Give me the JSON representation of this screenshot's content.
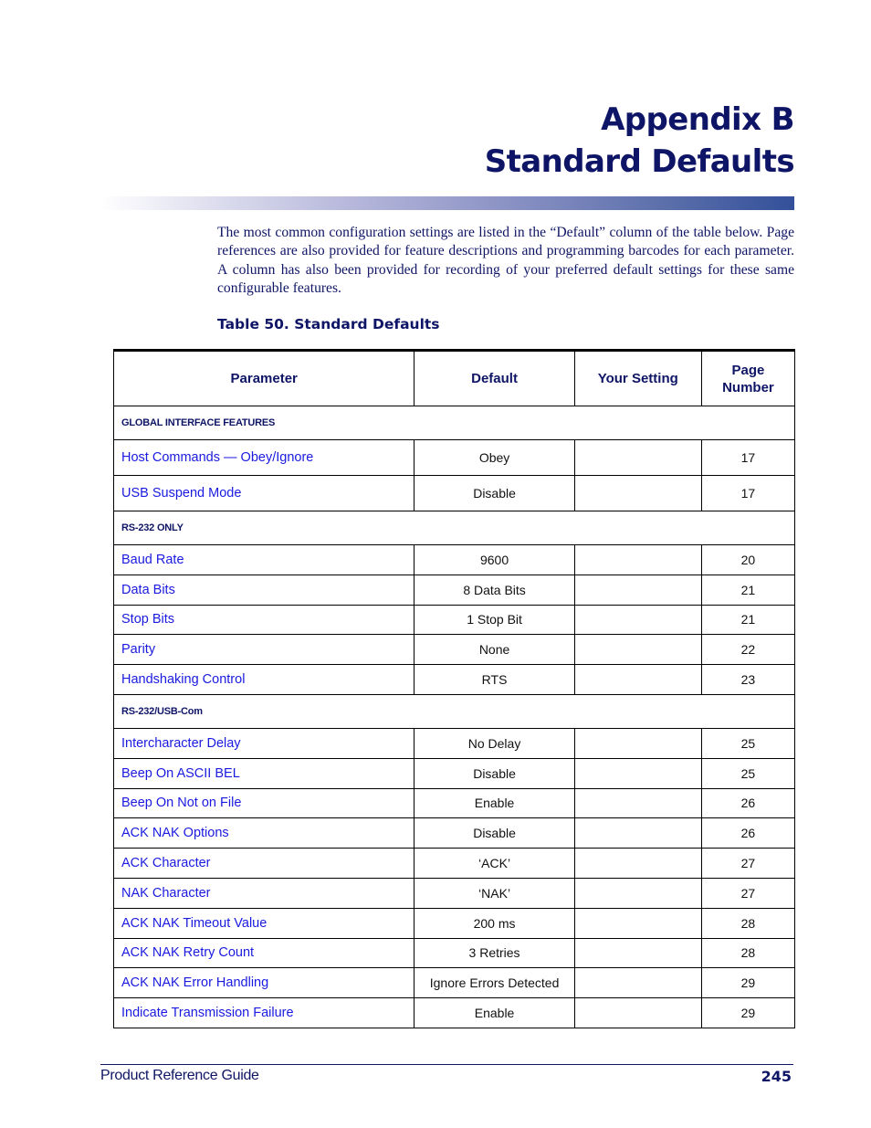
{
  "header": {
    "title_line1": "Appendix B",
    "title_line2": "Standard Defaults"
  },
  "intro_text": "The most common configuration settings are listed in the “Default” column of the table below. Page references are also provided for feature descriptions and programming barcodes for each parameter. A column has also been provided for recording of your preferred default settings for these same configurable features.",
  "table": {
    "caption": "Table 50. Standard Defaults",
    "columns": {
      "parameter": "Parameter",
      "default": "Default",
      "your_setting": "Your Setting",
      "page_line1": "Page",
      "page_line2": "Number"
    },
    "sections": [
      {
        "title": "GLOBAL INTERFACE FEATURES",
        "rows": [
          {
            "parameter": "Host Commands — Obey/Ignore",
            "default": "Obey",
            "your_setting": "",
            "page": "17"
          },
          {
            "parameter": "USB Suspend Mode",
            "default": "Disable",
            "your_setting": "",
            "page": "17"
          }
        ]
      },
      {
        "title": "RS-232 ONLY",
        "rows": [
          {
            "parameter": "Baud Rate",
            "default": "9600",
            "your_setting": "",
            "page": "20"
          },
          {
            "parameter": "Data Bits",
            "default": "8 Data Bits",
            "your_setting": "",
            "page": "21"
          },
          {
            "parameter": "Stop Bits",
            "default": "1 Stop Bit",
            "your_setting": "",
            "page": "21"
          },
          {
            "parameter": "Parity",
            "default": "None",
            "your_setting": "",
            "page": "22"
          },
          {
            "parameter": "Handshaking Control",
            "default": "RTS",
            "your_setting": "",
            "page": "23"
          }
        ]
      },
      {
        "title": "RS-232/USB-Com",
        "rows": [
          {
            "parameter": "Intercharacter Delay",
            "default": "No Delay",
            "your_setting": "",
            "page": "25"
          },
          {
            "parameter": "Beep On ASCII BEL",
            "default": "Disable",
            "your_setting": "",
            "page": "25"
          },
          {
            "parameter": "Beep On Not on File",
            "default": "Enable",
            "your_setting": "",
            "page": "26"
          },
          {
            "parameter": "ACK NAK Options",
            "default": "Disable",
            "your_setting": "",
            "page": "26"
          },
          {
            "parameter": "ACK Character",
            "default": "‘ACK’",
            "your_setting": "",
            "page": "27"
          },
          {
            "parameter": "NAK Character",
            "default": "‘NAK’",
            "your_setting": "",
            "page": "27"
          },
          {
            "parameter": "ACK NAK Timeout Value",
            "default": "200 ms",
            "your_setting": "",
            "page": "28"
          },
          {
            "parameter": "ACK NAK Retry Count",
            "default": "3 Retries",
            "your_setting": "",
            "page": "28"
          },
          {
            "parameter": "ACK NAK Error Handling",
            "default": "Ignore Errors Detected",
            "your_setting": "",
            "page": "29"
          },
          {
            "parameter": "Indicate Transmission Failure",
            "default": "Enable",
            "your_setting": "",
            "page": "29"
          }
        ]
      }
    ]
  },
  "footer": {
    "guide_name": "Product Reference Guide",
    "page_number": "245"
  },
  "colors": {
    "heading": "#0f1566",
    "link": "#1a1ae0",
    "bar_end": "#33509a"
  }
}
